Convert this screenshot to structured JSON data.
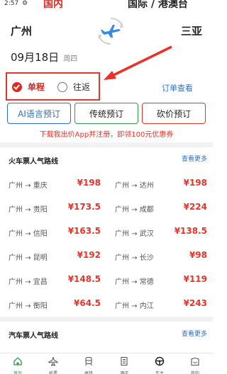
{
  "status": {
    "time": "2:57",
    "gear": "⚙"
  },
  "tabs": {
    "domestic": "国内",
    "international": "国际 / 港澳台"
  },
  "route": {
    "from": "广州",
    "to": "三亚"
  },
  "date": {
    "day": "09月18日",
    "weekday": "周四"
  },
  "trip_type": {
    "one_way": "单程",
    "round_trip": "往返",
    "selected": "one_way"
  },
  "order_check": "订单查看",
  "booking": {
    "ai": "AI语言预订",
    "traditional": "传统预订",
    "bargain": "砍价预订"
  },
  "promo": "下载我出价App并注册，即领100元优惠券",
  "train_section": {
    "title": "火车票人气路线",
    "more": "查看更多",
    "routes": [
      {
        "name": "广州 → 重庆",
        "price": "¥198"
      },
      {
        "name": "广州 → 达州",
        "price": "¥198"
      },
      {
        "name": "广州 → 贵阳",
        "price": "¥173.5"
      },
      {
        "name": "广州 → 成都",
        "price": "¥224"
      },
      {
        "name": "广州 → 信阳",
        "price": "¥163.5"
      },
      {
        "name": "广州 → 武汉",
        "price": "¥138.5"
      },
      {
        "name": "广州 → 昆明",
        "price": "¥192"
      },
      {
        "name": "广州 → 长沙",
        "price": "¥98"
      },
      {
        "name": "广州 → 宜昌",
        "price": "¥148.5"
      },
      {
        "name": "广州 → 常德",
        "price": "¥119"
      },
      {
        "name": "广州 → 衡阳",
        "price": "¥64.5"
      },
      {
        "name": "广州 → 内江",
        "price": "¥243"
      }
    ]
  },
  "bus_section": {
    "title": "汽车票人气路线",
    "more": "查看更多"
  },
  "nav": [
    {
      "label": "首页",
      "icon": "home-icon",
      "active": true
    },
    {
      "label": "机票",
      "icon": "plane-icon",
      "active": false
    },
    {
      "label": "高铁",
      "icon": "train-icon",
      "active": false
    },
    {
      "label": "酒店",
      "icon": "hotel-icon",
      "active": false
    },
    {
      "label": "车主",
      "icon": "steering-wheel-icon",
      "active": false
    },
    {
      "label": "我的",
      "icon": "profile-icon",
      "active": false
    }
  ],
  "colors": {
    "accent_red": "#e0281e",
    "link_blue": "#2d6ec9",
    "green": "#2e9c4d"
  }
}
